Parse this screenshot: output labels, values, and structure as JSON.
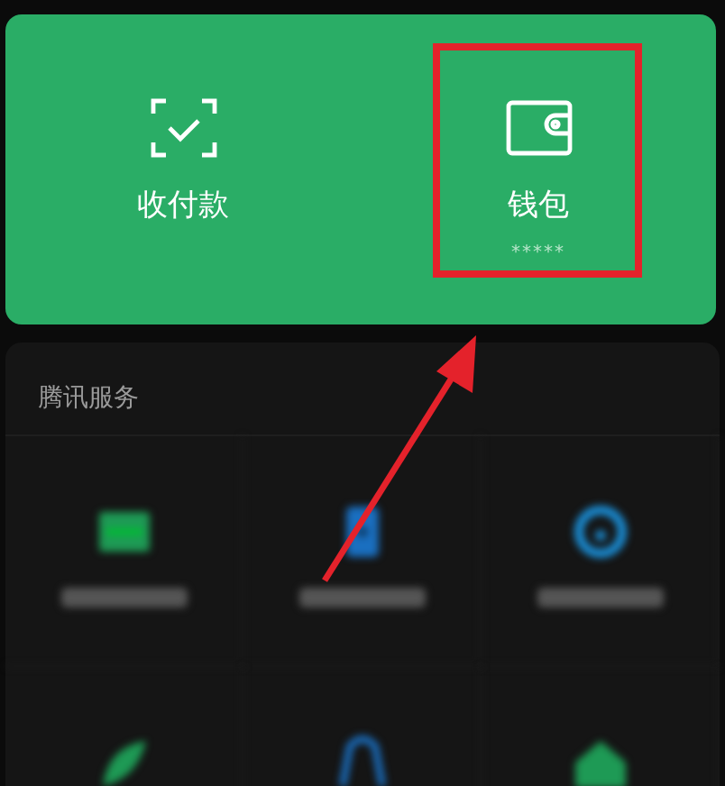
{
  "wallet_card": {
    "items": [
      {
        "kind": "scan",
        "label": "收付款"
      },
      {
        "kind": "wallet",
        "label": "钱包",
        "caption": "*****"
      }
    ]
  },
  "services": {
    "title": "腾讯服务",
    "tiles": [
      {
        "kind": "card"
      },
      {
        "kind": "phone"
      },
      {
        "kind": "ring"
      },
      {
        "kind": "leaf"
      },
      {
        "kind": "bag"
      },
      {
        "kind": "house"
      }
    ]
  }
}
